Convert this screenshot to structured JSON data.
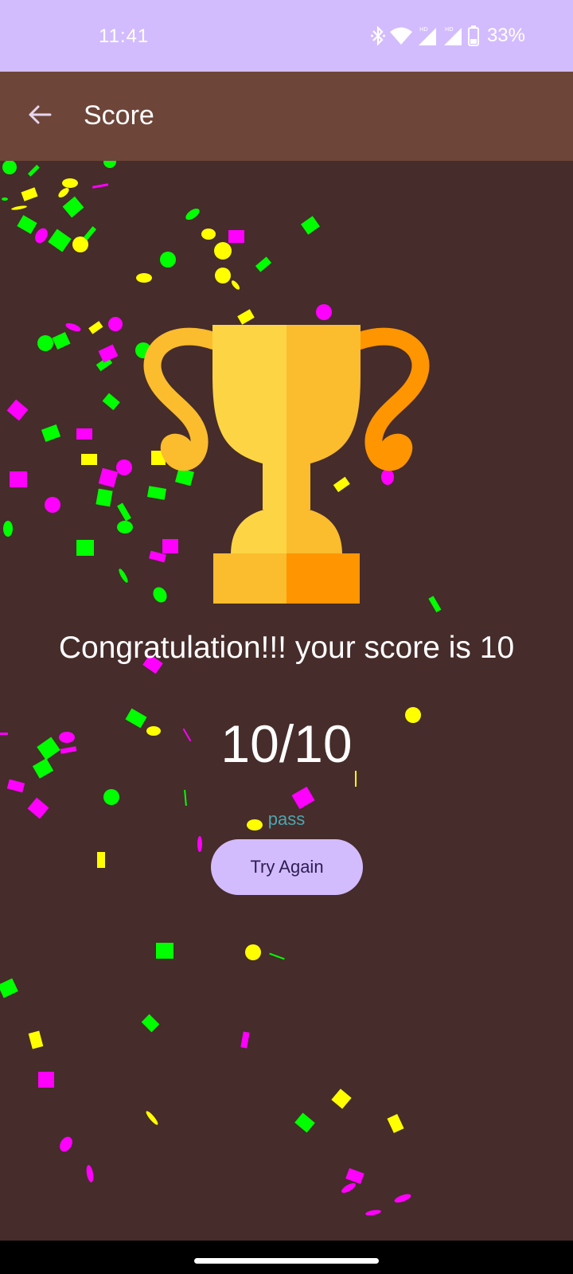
{
  "status_bar": {
    "time": "11:41",
    "battery_percent": "33%",
    "icons": [
      "bluetooth-icon",
      "wifi-icon",
      "signal-hd-icon",
      "signal-hd-icon",
      "battery-icon"
    ]
  },
  "app_bar": {
    "back_icon": "back-arrow-icon",
    "title": "Score"
  },
  "main": {
    "trophy_icon": "trophy-icon",
    "congrats_text": "Congratulation!!! your score is 10",
    "score_text": "10/10",
    "result_text": "pass",
    "try_again_label": "Try Again"
  },
  "colors": {
    "status_bar": "#d3bcfd",
    "app_bar": "#6e4539",
    "background": "#462c2a",
    "button": "#d3bcfd",
    "result_text": "#4aa7b0",
    "confetti": [
      "#ffff00",
      "#00ff00",
      "#ff00ff"
    ]
  }
}
